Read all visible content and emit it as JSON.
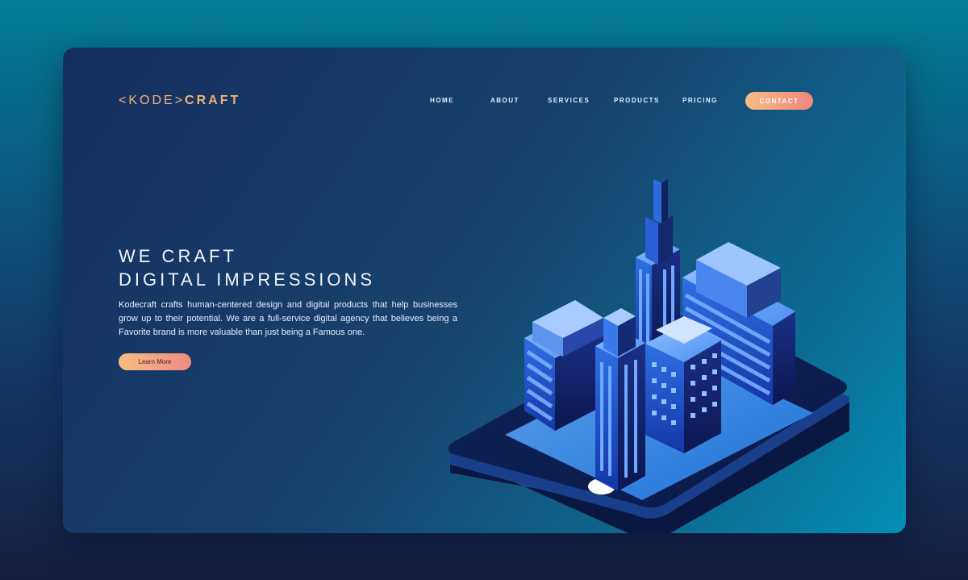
{
  "brand": {
    "logo_light": "<KODE>",
    "logo_bold": "CRAFT"
  },
  "nav": {
    "items": [
      "HOME",
      "ABOUT",
      "SERVICES",
      "PRODUCTS",
      "PRICING"
    ],
    "contact_label": "CONTACT"
  },
  "hero": {
    "title_line1": "WE CRAFT",
    "title_line2": "DIGITAL IMPRESSIONS",
    "description": "Kodecraft crafts human-centered design and digital products that help businesses grow up to their potential. We are a full-service digital agency that believes being a Favorite brand is more valuable than just being a Famous one.",
    "cta_label": "Learn More"
  },
  "colors": {
    "accent_gradient_start": "#f6bd83",
    "accent_gradient_end": "#f0867f",
    "card_dark": "#152f60",
    "card_light": "#028fb4"
  },
  "illustration": {
    "name": "isometric-city-on-phone"
  }
}
